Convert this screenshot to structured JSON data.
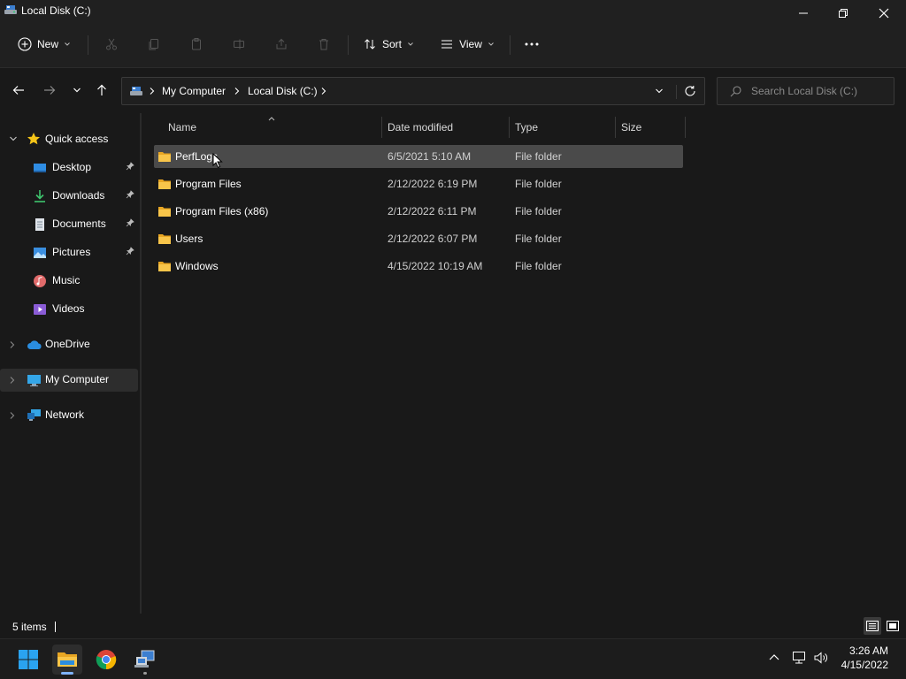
{
  "window": {
    "title": "Local Disk (C:)"
  },
  "toolbar": {
    "new_label": "New",
    "sort_label": "Sort",
    "view_label": "View"
  },
  "breadcrumb": {
    "items": [
      "My Computer",
      "Local Disk (C:)"
    ]
  },
  "search": {
    "placeholder": "Search Local Disk (C:)"
  },
  "sidebar": {
    "items": [
      {
        "label": "Quick access",
        "icon": "star-icon"
      },
      {
        "label": "Desktop",
        "icon": "desktop-icon",
        "pinned": true
      },
      {
        "label": "Downloads",
        "icon": "download-icon",
        "pinned": true
      },
      {
        "label": "Documents",
        "icon": "document-icon",
        "pinned": true
      },
      {
        "label": "Pictures",
        "icon": "picture-icon",
        "pinned": true
      },
      {
        "label": "Music",
        "icon": "music-icon"
      },
      {
        "label": "Videos",
        "icon": "video-icon"
      },
      {
        "label": "OneDrive",
        "icon": "cloud-icon"
      },
      {
        "label": "My Computer",
        "icon": "computer-icon",
        "selected": true
      },
      {
        "label": "Network",
        "icon": "network-icon"
      }
    ]
  },
  "columns": [
    "Name",
    "Date modified",
    "Type",
    "Size"
  ],
  "files": [
    {
      "name": "PerfLogs",
      "date": "6/5/2021 5:10 AM",
      "type": "File folder",
      "size": ""
    },
    {
      "name": "Program Files",
      "date": "2/12/2022 6:19 PM",
      "type": "File folder",
      "size": ""
    },
    {
      "name": "Program Files (x86)",
      "date": "2/12/2022 6:11 PM",
      "type": "File folder",
      "size": ""
    },
    {
      "name": "Users",
      "date": "2/12/2022 6:07 PM",
      "type": "File folder",
      "size": ""
    },
    {
      "name": "Windows",
      "date": "4/15/2022 10:19 AM",
      "type": "File folder",
      "size": ""
    }
  ],
  "status": {
    "item_count": "5 items"
  },
  "taskbar": {
    "time": "3:26 AM",
    "date": "4/15/2022"
  },
  "colors": {
    "accent": "#0078d4",
    "folder": "#f8c54a",
    "selection": "#4a4a4a"
  }
}
